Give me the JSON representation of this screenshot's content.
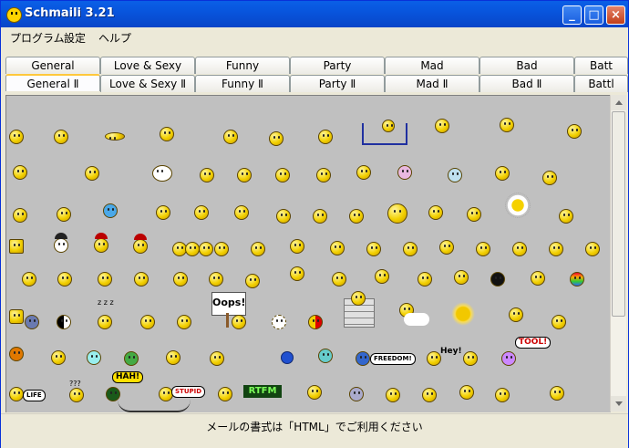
{
  "window": {
    "title": "Schmaili 3.21",
    "buttons": {
      "minimize": "_",
      "maximize": "□",
      "close": "×"
    }
  },
  "menu": [
    "プログラム",
    "設定",
    "ヘルプ"
  ],
  "tabs_row1": [
    "General",
    "Love & Sexy",
    "Funny",
    "Party",
    "Mad",
    "Bad",
    "Batt"
  ],
  "tabs_row2": [
    "General Ⅱ",
    "Love & Sexy Ⅱ",
    "Funny Ⅱ",
    "Party Ⅱ",
    "Mad Ⅱ",
    "Bad Ⅱ",
    "Battl"
  ],
  "active_tab": "General Ⅱ",
  "panel_texts": {
    "oops": "Oops!",
    "hey": "Hey!",
    "tool": "TOOL!",
    "freedom": "FREEDOM!",
    "life": "LIFE",
    "hah": "HAH!",
    "stupid": "STUPID",
    "rtfm": "RTFM",
    "question": "???",
    "zzz": "z z z"
  },
  "status": "メールの書式は「HTML」でご利用ください",
  "colors": {
    "title_bar": "#0855dd",
    "panel_bg": "#c0c0c0",
    "smiley": "#f2d000",
    "active_tab_accent": "#ffc83c"
  }
}
